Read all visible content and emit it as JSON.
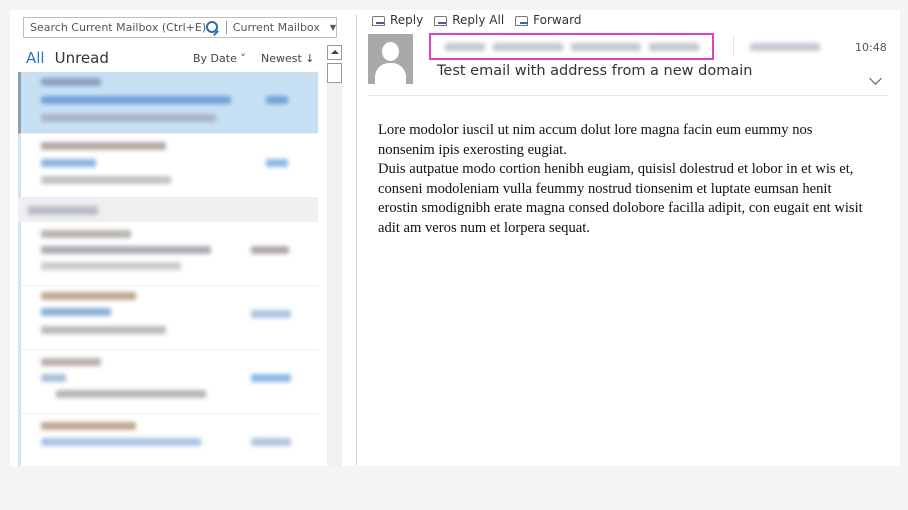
{
  "search": {
    "placeholder": "Search Current Mailbox (Ctrl+E)",
    "scope": "Current Mailbox",
    "search_icon": "search-icon",
    "dropdown_icon": "chevron-down-icon"
  },
  "filters": {
    "all_label": "All",
    "unread_label": "Unread",
    "sort_by": "By Date ˅",
    "order": "Newest ↓"
  },
  "message_list": {
    "items": [
      {
        "selected": true,
        "blurred": true
      },
      {
        "selected": false,
        "blurred": true
      },
      {
        "group_header": true,
        "blurred": true
      },
      {
        "selected": false,
        "blurred": true
      },
      {
        "selected": false,
        "blurred": true
      },
      {
        "selected": false,
        "blurred": true
      },
      {
        "selected": false,
        "blurred": true
      }
    ]
  },
  "toolbar": {
    "reply_label": "Reply",
    "reply_all_label": "Reply All",
    "forward_label": "Forward"
  },
  "message": {
    "sender": "[blurred sender address]",
    "recipient": "[blurred recipient]",
    "time": "10:48",
    "subject": "Test email with address from a new domain",
    "body_paragraphs": [
      "Lore modolor iuscil ut nim accum dolut lore magna facin eum eummy nos nonsenim ipis exerosting eugiat.",
      "Duis autpatue modo cortion henibh eugiam, quisisl dolestrud et lobor in et wis et, conseni modoleniam vulla feummy nostrud tionsenim et luptate eumsan henit erostin smodignibh erate magna consed dolobore facilla adipit, con eugait ent wisit adit am veros num et lorpera sequat."
    ]
  },
  "colors": {
    "accent": "#2e75c7",
    "selected_row": "#c8e0f4",
    "highlight_box": "#e040c8"
  }
}
